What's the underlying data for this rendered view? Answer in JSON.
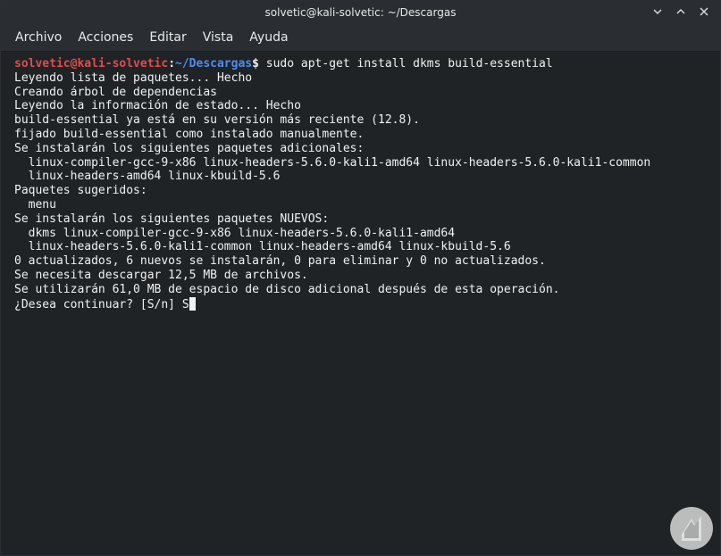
{
  "window": {
    "title": "solvetic@kali-solvetic: ~/Descargas",
    "controls": [
      "minimize-icon",
      "maximize-icon",
      "close-icon"
    ]
  },
  "menubar": {
    "items": [
      {
        "label": "Archivo"
      },
      {
        "label": "Acciones"
      },
      {
        "label": "Editar"
      },
      {
        "label": "Vista"
      },
      {
        "label": "Ayuda"
      }
    ]
  },
  "terminal": {
    "prompt": {
      "user_host": "solvetic@kali-solvetic",
      "colon": ":",
      "path": "~/Descargas",
      "symbol": "$",
      "command": " sudo apt-get install dkms build-essential"
    },
    "output": [
      "Leyendo lista de paquetes... Hecho",
      "Creando árbol de dependencias",
      "Leyendo la información de estado... Hecho",
      "build-essential ya está en su versión más reciente (12.8).",
      "fijado build-essential como instalado manualmente.",
      "Se instalarán los siguientes paquetes adicionales:",
      "  linux-compiler-gcc-9-x86 linux-headers-5.6.0-kali1-amd64 linux-headers-5.6.0-kali1-common",
      "  linux-headers-amd64 linux-kbuild-5.6",
      "Paquetes sugeridos:",
      "  menu",
      "Se instalarán los siguientes paquetes NUEVOS:",
      "  dkms linux-compiler-gcc-9-x86 linux-headers-5.6.0-kali1-amd64",
      "  linux-headers-5.6.0-kali1-common linux-headers-amd64 linux-kbuild-5.6",
      "0 actualizados, 6 nuevos se instalarán, 0 para eliminar y 0 no actualizados.",
      "Se necesita descargar 12,5 MB de archivos.",
      "Se utilizarán 61,0 MB de espacio de disco adicional después de esta operación."
    ],
    "final_question": "¿Desea continuar? [S/n] ",
    "typed_input": "S"
  },
  "colors": {
    "background": "#1f2326",
    "prompt_user": "#e34b4b",
    "prompt_path": "#4e8cf0",
    "text": "#f1f1f1"
  }
}
